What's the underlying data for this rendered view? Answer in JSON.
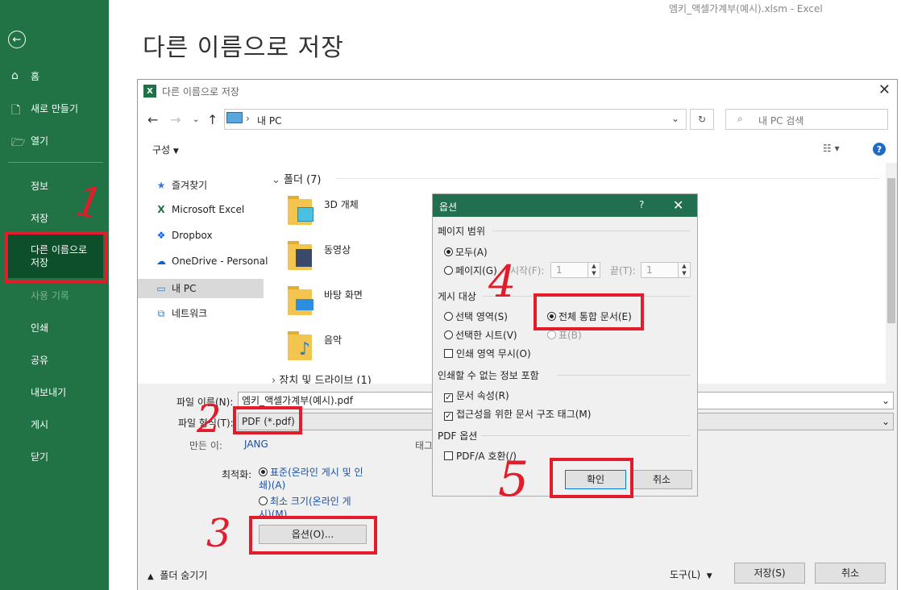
{
  "window": {
    "title": "엠키_액셀가계부(예시).xlsm  -  Excel"
  },
  "backstage": {
    "title": "다른 이름으로 저장",
    "nav": [
      {
        "label": "홈",
        "icon": "home-icon"
      },
      {
        "label": "새로 만들기",
        "icon": "new-file-icon"
      },
      {
        "label": "열기",
        "icon": "folder-open-icon"
      },
      {
        "label": "정보"
      },
      {
        "label": "저장"
      },
      {
        "label": "다른 이름으로 저장",
        "selected": true
      },
      {
        "label": "사용 기록",
        "disabled": true
      },
      {
        "label": "인쇄"
      },
      {
        "label": "공유"
      },
      {
        "label": "내보내기"
      },
      {
        "label": "게시"
      },
      {
        "label": "닫기"
      }
    ]
  },
  "save_dialog": {
    "title": "다른 이름으로 저장",
    "address": "내 PC",
    "search_placeholder": "내 PC 검색",
    "organize_label": "구성",
    "nav_pane": [
      {
        "label": "즐겨찾기",
        "icon": "star-icon"
      },
      {
        "label": "Microsoft Excel",
        "icon": "excel-icon"
      },
      {
        "label": "Dropbox",
        "icon": "dropbox-icon"
      },
      {
        "label": "OneDrive - Personal",
        "icon": "onedrive-icon"
      },
      {
        "label": "내 PC",
        "icon": "pc-icon",
        "selected": true
      },
      {
        "label": "네트워크",
        "icon": "network-icon"
      }
    ],
    "folder_group": "폴더 (7)",
    "folders": [
      "3D 개체",
      "동영상",
      "바탕 화면",
      "음악"
    ],
    "drive_group": "장치 및 드라이브 (1)",
    "filename_label": "파일 이름(N):",
    "filename_value": "엠키_액셀가계부(예시).pdf",
    "filetype_label": "파일 형식(T):",
    "filetype_value": "PDF (*.pdf)",
    "author_label": "만든 이:",
    "author_value": "JANG",
    "tags_label": "태그",
    "optimize_label": "최적화:",
    "optimize_standard": "표준(온라인 게시 및 인쇄)(A)",
    "optimize_min": "최소 크기(온라인 게시)(M)",
    "options_button": "옵션(O)...",
    "hide_folders": "폴더 숨기기",
    "tools_label": "도구(L)",
    "save_button": "저장(S)",
    "cancel_button": "취소"
  },
  "options_dialog": {
    "title": "옵션",
    "help": "?",
    "page_range_label": "페이지 범위",
    "all_label": "모두(A)",
    "pages_label": "페이지(G)",
    "from_label": "시작(F):",
    "from_value": "1",
    "to_label": "끝(T):",
    "to_value": "1",
    "publish_what_label": "게시 대상",
    "selection_label": "선택 영역(S)",
    "entire_workbook_label": "전체 통합 문서(E)",
    "active_sheets_label": "선택한 시트(V)",
    "table_label": "표(B)",
    "ignore_print_areas_label": "인쇄 영역 무시(O)",
    "non_printing_label": "인쇄할 수 없는 정보 포함",
    "doc_properties_label": "문서 속성(R)",
    "accessibility_tags_label": "접근성을 위한 문서 구조 태그(M)",
    "pdf_options_label": "PDF 옵션",
    "pdfa_label": "PDF/A 호환(/)",
    "ok_button": "확인",
    "cancel_button": "취소"
  },
  "annotations": [
    "1",
    "2",
    "3",
    "4",
    "5"
  ]
}
